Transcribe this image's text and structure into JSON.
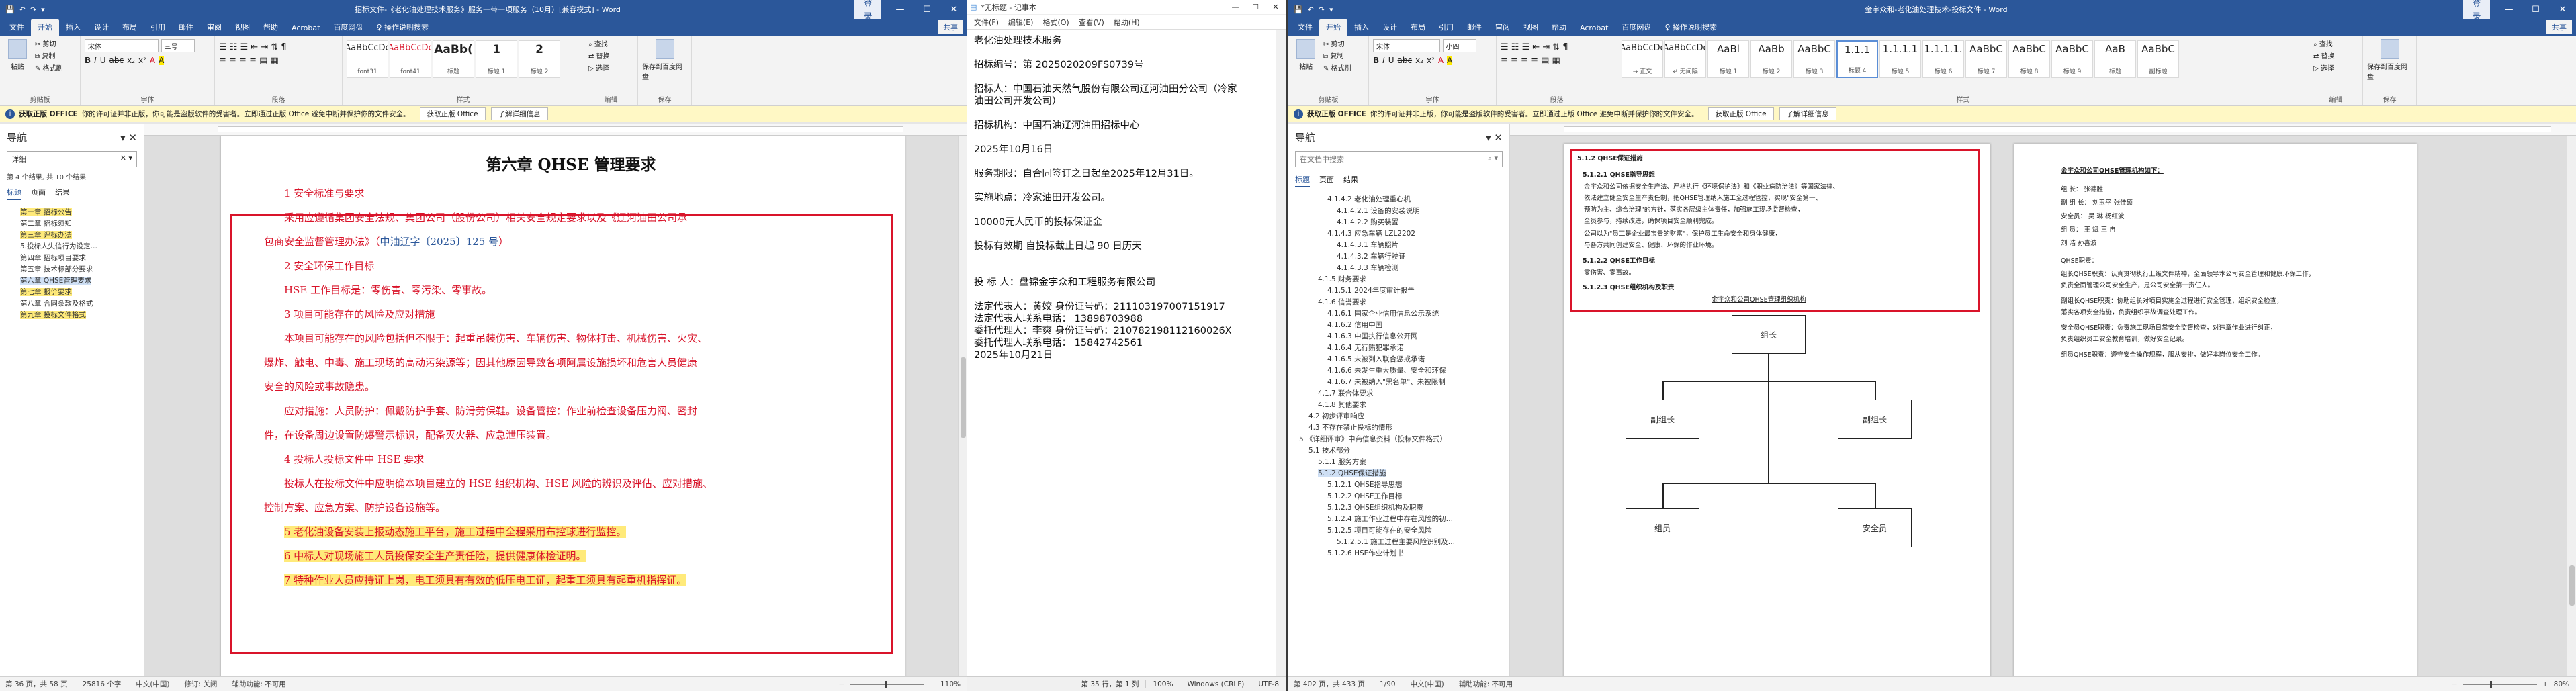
{
  "common": {
    "quick_access": [
      "💾",
      "↶",
      "↷",
      "▾"
    ],
    "login": "登录",
    "min": "—",
    "max": "☐",
    "close": "✕",
    "share": "共享",
    "notice_bold": "获取正版 OFFICE",
    "notice_text": "你的许可证并非正版，你可能是盗版软件的受害者。立即通过正版 Office 避免中断并保护你的文件安全。",
    "notice_btn1": "获取正版 Office",
    "notice_btn2": "了解详细信息",
    "menus": [
      "文件",
      "开始",
      "插入",
      "设计",
      "布局",
      "引用",
      "邮件",
      "审阅",
      "视图",
      "帮助",
      "Acrobat",
      "百度网盘",
      "♀ 操作说明搜索"
    ],
    "ribbon": {
      "paste": "粘贴",
      "cut": "✂ 剪切",
      "copy": "⧉ 复制",
      "fmt": "✎ 格式刷",
      "clipboard": "剪贴板",
      "font": "字体",
      "paragraph": "段落",
      "styles": "样式",
      "edit": "编辑",
      "find": "⌕ 查找",
      "replace": "⇄ 替换",
      "select": "▷ 选择",
      "save_baidu": "保存到百度网盘",
      "save": "保存"
    }
  },
  "w1": {
    "title": "招标文件-《老化油处理技术服务》服务一带一项服务（10月）[兼容模式] - Word",
    "font_name": "宋体",
    "font_size": "三号",
    "font_btns": [
      "B",
      "I",
      "U",
      "abc",
      "x₂",
      "x²",
      "A",
      "A"
    ],
    "styles": [
      {
        "preview": "AaBbCcDc",
        "name": "font31"
      },
      {
        "preview": "AaBbCcDc",
        "name": "font41"
      },
      {
        "preview": "AaBb(",
        "name": "标题"
      },
      {
        "preview": "1",
        "name": "标题 1"
      },
      {
        "preview": "2",
        "name": "标题 2"
      }
    ],
    "nav": {
      "title": "导航",
      "search": "详细",
      "results": "第 4 个结果, 共 10 个结果",
      "tabs": [
        "标题",
        "页面",
        "结果"
      ],
      "items": [
        {
          "t": "第一章 招标公告",
          "h": "y"
        },
        {
          "t": "第二章 招标须知",
          "h": "n"
        },
        {
          "t": "第三章 评标办法",
          "h": "y"
        },
        {
          "t": "",
          "h": "n"
        },
        {
          "t": "",
          "h": "n"
        },
        {
          "t": "5.投标人失信行为设定…",
          "h": "n"
        },
        {
          "t": "",
          "h": "n"
        },
        {
          "t": "",
          "h": "n"
        },
        {
          "t": "",
          "h": "n"
        },
        {
          "t": "",
          "h": "n"
        },
        {
          "t": "第四章 招标项目要求",
          "h": "n"
        },
        {
          "t": "第五章 技术标部分要求",
          "h": "n"
        },
        {
          "t": "第六章 QHSE管理要求",
          "h": "b"
        },
        {
          "t": "第七章 报价要求",
          "h": "y"
        },
        {
          "t": "第八章 合同条款及格式",
          "h": "n"
        },
        {
          "t": "第九章 投标文件格式",
          "h": "y"
        }
      ]
    },
    "doc": {
      "chapter": "第六章   QHSE 管理要求",
      "l1": "1 安全标准与要求",
      "l2": "采用应遵循集团安全法规、集团公司（股份公司）相关安全规定要求以及《辽河油田公司承",
      "l3a": "包商安全监督管理办法》（",
      "l3u": "中油辽字〔2025〕125 号",
      "l3b": "）",
      "l4": "2 安全环保工作目标",
      "l5": "HSE 工作目标是：零伤害、零污染、零事故。",
      "l6": "3 项目可能存在的风险及应对措施",
      "l7": "本项目可能存在的风险包括但不限于：起重吊装伤害、车辆伤害、物体打击、机械伤害、火灾、",
      "l8": "爆炸、触电、中毒、施工现场的高动污染源等；因其他原因导致各项阿属设施损坏和危害人员健康",
      "l9": "安全的风险或事故隐患。",
      "l10": "应对措施：人员防护：佩戴防护手套、防滑劳保鞋。设备管控：作业前检查设备压力阀、密封",
      "l11": "件，在设备周边设置防爆警示标识，配备灭火器、应急泄压装置。",
      "l12": "4 投标人投标文件中 HSE 要求",
      "l13": "投标人在投标文件中应明确本项目建立的 HSE 组织机构、HSE 风险的辨识及评估、应对措施、",
      "l14": "控制方案、应急方案、防护设备设施等。",
      "l15": "5 老化油设备安装上报动态施工平台，施工过程中全程采用布控球进行监控。",
      "l16": "6 中标人对现场施工人员投保安全生产责任险，提供健康体检证明。",
      "l17": "7 特种作业人员应持证上岗，电工须具有有效的低压电工证，起重工须具有起重机指挥证。"
    },
    "status": [
      "第 36 页，共 58 页",
      "25816 个字",
      "中文(中国)",
      "修订: 关闭",
      "辅助功能: 不可用"
    ],
    "zoom": "110%"
  },
  "np": {
    "title": "*无标题 - 记事本",
    "menus": [
      "文件(F)",
      "编辑(E)",
      "格式(O)",
      "查看(V)",
      "帮助(H)"
    ],
    "lines": [
      "老化油处理技术服务",
      "",
      "招标编号：第 2025020209FS0739号",
      "",
      "招标人：中国石油天然气股份有限公司辽河油田分公司（冷家",
      "油田公司开发公司）",
      "",
      "招标机构：中国石油辽河油田招标中心",
      "",
      "2025年10月16日",
      "",
      "服务期限：自合同签订之日起至2025年12月31日。",
      "",
      "实施地点：冷家油田开发公司。",
      "",
      "10000元人民币的投标保证金",
      "",
      "投标有效期 自投标截止日起 90  日历天",
      "",
      "",
      "投 标 人：盘锦金宇众和工程服务有限公司",
      "",
      "法定代表人：黄姣    身份证号码：211103197007151917",
      "法定代表人联系电话：   13898703988",
      "委托代理人：李爽    身份证号码：210782198112160026X",
      "委托代理人联系电话：   15842742561",
      "2025年10月21日"
    ],
    "status": [
      "第 35 行，第 1 列",
      "100%",
      "Windows (CRLF)",
      "UTF-8"
    ]
  },
  "w3": {
    "title": "金宇众和-老化油处理技术-投标文件 - Word",
    "font_name": "宋体",
    "font_size": "小四",
    "styles": [
      {
        "preview": "AaBbCcDc",
        "name": "→ 正文"
      },
      {
        "preview": "AaBbCcDc",
        "name": "↵ 无间隔"
      },
      {
        "preview": "AaBl",
        "name": "标题 1"
      },
      {
        "preview": "AaBb",
        "name": "标题 2"
      },
      {
        "preview": "AaBbC",
        "name": "标题 3"
      },
      {
        "preview": "1.1.1",
        "name": "标题 4"
      },
      {
        "preview": "1.1.1.1",
        "name": "标题 5"
      },
      {
        "preview": "1.1.1.1.",
        "name": "标题 6"
      },
      {
        "preview": "AaBbC",
        "name": "标题 7"
      },
      {
        "preview": "AaBbC",
        "name": "标题 8"
      },
      {
        "preview": "AaBbC",
        "name": "标题 9"
      },
      {
        "preview": "AaB",
        "name": "标题"
      },
      {
        "preview": "AaBbC",
        "name": "副标题"
      }
    ],
    "nav": {
      "title": "导航",
      "search": "在文档中搜索",
      "tabs": [
        "标题",
        "页面",
        "结果"
      ],
      "items": [
        {
          "t": "4.1.4.2 老化油处理重心机",
          "i": 3,
          "h": "n"
        },
        {
          "t": "4.1.4.2.1 设备的安装说明",
          "i": 4,
          "h": "n"
        },
        {
          "t": "4.1.4.2.2 购买装置",
          "i": 4,
          "h": "n"
        },
        {
          "t": "4.1.4.3 应急车辆 LZL2202",
          "i": 3,
          "h": "n"
        },
        {
          "t": "4.1.4.3.1 车辆照片",
          "i": 4,
          "h": "n"
        },
        {
          "t": "4.1.4.3.2 车辆行驶证",
          "i": 4,
          "h": "n"
        },
        {
          "t": "4.1.4.3.3 车辆检测",
          "i": 4,
          "h": "n"
        },
        {
          "t": "4.1.5 财务要求",
          "i": 2,
          "h": "n"
        },
        {
          "t": "4.1.5.1 2024年度审计报告",
          "i": 3,
          "h": "n"
        },
        {
          "t": "4.1.6 信誉要求",
          "i": 2,
          "h": "n"
        },
        {
          "t": "4.1.6.1 国家企业信用信息公示系统",
          "i": 3,
          "h": "n"
        },
        {
          "t": "4.1.6.2 信用中国",
          "i": 3,
          "h": "n"
        },
        {
          "t": "4.1.6.3 中国执行信息公开网",
          "i": 3,
          "h": "n"
        },
        {
          "t": "4.1.6.4 无行贿犯罪承诺",
          "i": 3,
          "h": "n"
        },
        {
          "t": "4.1.6.5 未被列入联合惩戒承诺",
          "i": 3,
          "h": "n"
        },
        {
          "t": "4.1.6.6 未发生重大质量、安全和环保",
          "i": 3,
          "h": "n"
        },
        {
          "t": "4.1.6.7 未被纳入\"黑名单\"、未被限制",
          "i": 3,
          "h": "n"
        },
        {
          "t": "4.1.7 联合体要求",
          "i": 2,
          "h": "n"
        },
        {
          "t": "4.1.8 其他要求",
          "i": 2,
          "h": "n"
        },
        {
          "t": "4.2 初步评审响应",
          "i": 1,
          "h": "n"
        },
        {
          "t": "4.3 不存在禁止投标的情形",
          "i": 1,
          "h": "n"
        },
        {
          "t": "5 《详细评审》中商信息资料（投标文件格式）",
          "i": 0,
          "h": "n"
        },
        {
          "t": "5.1 技术部分",
          "i": 1,
          "h": "n"
        },
        {
          "t": "5.1.1 服务方案",
          "i": 2,
          "h": "n"
        },
        {
          "t": "5.1.2 QHSE保证措施",
          "i": 2,
          "h": "b"
        },
        {
          "t": "5.1.2.1 QHSE指导思想",
          "i": 3,
          "h": "n"
        },
        {
          "t": "5.1.2.2 QHSE工作目标",
          "i": 3,
          "h": "n"
        },
        {
          "t": "5.1.2.3 QHSE组织机构及职责",
          "i": 3,
          "h": "n"
        },
        {
          "t": "5.1.2.4 施工作业过程中存在风险的初…",
          "i": 3,
          "h": "n"
        },
        {
          "t": "5.1.2.5 项目可能存在的安全风险",
          "i": 3,
          "h": "n"
        },
        {
          "t": "5.1.2.5.1 施工过程主要风险识别及…",
          "i": 4,
          "h": "n"
        },
        {
          "t": "5.1.2.6 HSE作业计划书",
          "i": 3,
          "h": "n"
        }
      ]
    },
    "doc": {
      "h1": "5.1.2 QHSE保证措施",
      "h2": "5.1.2.1 QHSE指导思想",
      "p1": "金宇众和公司依据安全生产法、严格执行《环境保护法》和《职业病防治法》等国家法律、",
      "p2": "依法建立健全安全生产责任制，把QHSE管理纳入施工全过程管控，实现\"安全第一、",
      "p3": "预防为主、综合治理\"的方针，落实各层级主体责任，加强施工现场监督检查，",
      "p4": "全员参与，持续改进，确保项目安全顺利完成。",
      "p5": "公司以为\"员工是企业最宝贵的财富\"，保护员工生命安全和身体健康，",
      "p6": "与各方共同创建安全、健康、环保的作业环境。",
      "h3": "5.1.2.2 QHSE工作目标",
      "p7": "零伤害、零事故。",
      "h4": "5.1.2.3 QHSE组织机构及职责",
      "p8": "金宇众和公司QHSE管理组织机构",
      "org_top": "组长",
      "org_left": "副组长",
      "org_right": "副组长",
      "org_bl": "组员",
      "org_br": "安全员",
      "rh": "金宇众和公司QHSE管理机构如下：",
      "r1": "组    长：  张德胜",
      "r2": "副 组 长：  刘玉平     张佳硕",
      "r3": "安全员：  吴  琳     杨红波",
      "r4": "组    员：  王   斌     王   冉",
      "r5": "          刘    浩     孙喜波",
      "r6": "QHSE职责：",
      "r7": "组长QHSE职责：认真贯彻执行上级文件精神，全面领导本公司安全管理和健康环保工作，",
      "r8": "负责全面管理公司安全生产，是公司安全第一责任人。",
      "r9": "副组长QHSE职责：协助组长对项目实施全过程进行安全管理，组织安全检查，",
      "r10": "落实各项安全措施，负责组织事故调查处理工作。",
      "r11": "安全员QHSE职责：负责施工现场日常安全监督检查，对违章作业进行纠正，",
      "r12": "负责组织员工安全教育培训，做好安全记录。",
      "r13": "组员QHSE职责：遵守安全操作规程，服从安排，做好本岗位安全工作。"
    },
    "status": [
      "第 402 页，共 433 页",
      "1/90"
    ],
    "zoom": "80%"
  }
}
